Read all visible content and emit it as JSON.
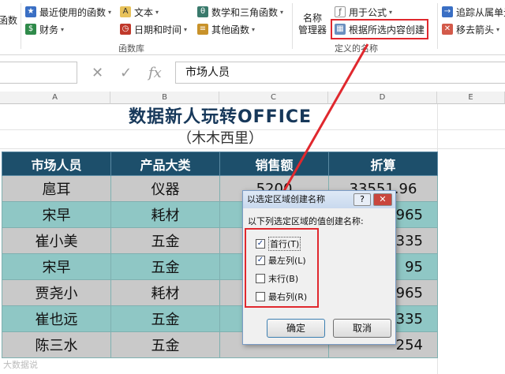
{
  "ribbon": {
    "left_partial_label": "函数",
    "recent": "最近使用的函数",
    "financial": "财务",
    "text": "文本",
    "datetime": "日期和时间",
    "math": "数学和三角函数",
    "other": "其他函数",
    "function_library": "函数库",
    "name_manager_line1": "名称",
    "name_manager_line2": "管理器",
    "use_in_formula": "用于公式",
    "create_from_selection": "根据所选内容创建",
    "defined_names": "定义的名称",
    "trace_dependents": "追踪从属单元",
    "remove_arrows": "移去箭头"
  },
  "formula_bar": {
    "fx_label": "fx",
    "content": "市场人员"
  },
  "sheet": {
    "columns": [
      "A",
      "B",
      "C",
      "D",
      "E"
    ],
    "title": "数据新人玩转OFFICE",
    "subtitle": "（木木西里）",
    "headers": [
      "市场人员",
      "产品大类",
      "销售额",
      "折算"
    ],
    "rows": [
      [
        "扈耳",
        "仪器",
        "5200",
        "33551.96"
      ],
      [
        "宋早",
        "耗材",
        "",
        "965"
      ],
      [
        "崔小美",
        "五金",
        "",
        "335"
      ],
      [
        "宋早",
        "五金",
        "",
        "95"
      ],
      [
        "贾尧小",
        "耗材",
        "",
        "965"
      ],
      [
        "崔也远",
        "五金",
        "",
        "335"
      ],
      [
        "陈三水",
        "五金",
        "",
        "254"
      ]
    ]
  },
  "dialog": {
    "title": "以选定区域创建名称",
    "help": "?",
    "close": "✕",
    "prompt": "以下列选定区域的值创建名称:",
    "options": [
      {
        "label": "首行(T)",
        "checked": true
      },
      {
        "label": "最左列(L)",
        "checked": true
      },
      {
        "label": "末行(B)",
        "checked": false
      },
      {
        "label": "最右列(R)",
        "checked": false
      }
    ],
    "ok": "确定",
    "cancel": "取消"
  },
  "watermark": "大数据说",
  "colors": {
    "header_bg": "#1d4f6b",
    "row_gray": "#c9c9c9",
    "row_teal": "#8fc7c5",
    "highlight_red": "#e0282e",
    "title_color": "#17385a"
  }
}
